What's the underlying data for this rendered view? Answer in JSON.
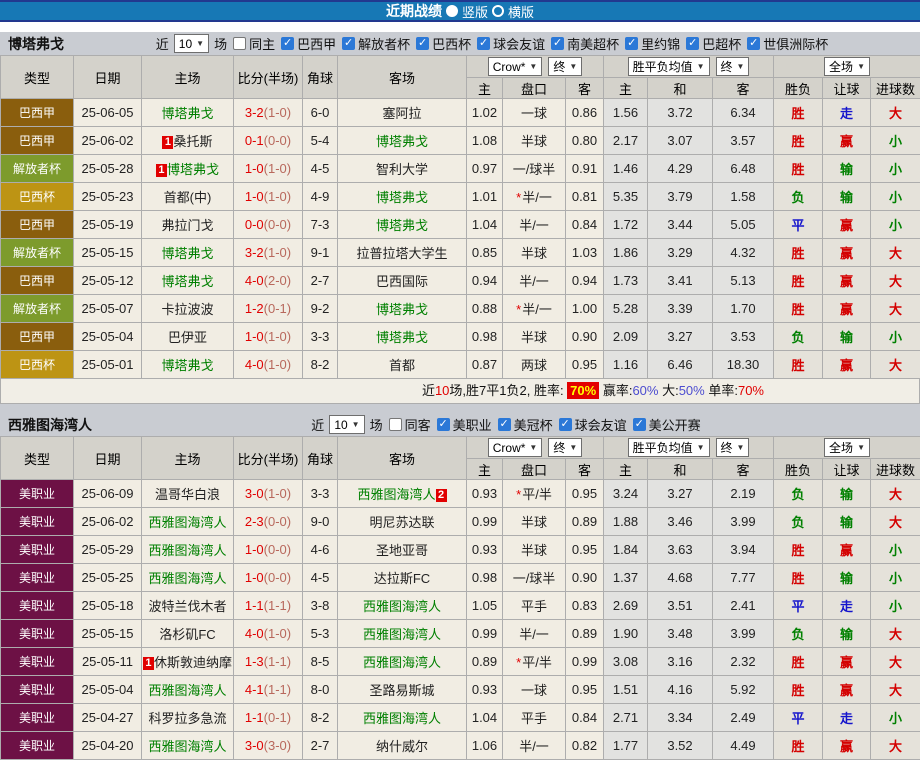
{
  "title_bar": {
    "title": "近期战绩",
    "options": [
      {
        "label": "竖版",
        "selected": true
      },
      {
        "label": "横版",
        "selected": false
      }
    ]
  },
  "colors": {
    "header_blue": "#1778b5",
    "win_red": "#d40000",
    "draw_blue": "#1414cc",
    "lose_green": "#008000",
    "focus_team_green": "#008000",
    "score_red": "#e10000",
    "badge_league_bra_a": "#8a5e0d",
    "badge_libertadores": "#7d9b2c",
    "badge_bra_cup": "#bd9414",
    "badge_mls": "#6d1145"
  },
  "columns": {
    "type": "类型",
    "date": "日期",
    "home": "主场",
    "score": "比分(半场)",
    "corner": "角球",
    "away": "客场",
    "odds_company": "Crow*",
    "odds_stage": "终",
    "avg_label": "胜平负均值",
    "avg_stage": "终",
    "scope": "全场",
    "o_home": "主",
    "o_handicap": "盘口",
    "o_away": "客",
    "a_win": "主",
    "a_draw": "和",
    "a_lose": "客",
    "r_outcome": "胜负",
    "r_handicap": "让球",
    "r_goals": "进球数"
  },
  "sections": [
    {
      "team": "博塔弗戈",
      "near": "近",
      "count": "10",
      "games": "场",
      "same": "同主",
      "leagues": [
        "巴西甲",
        "解放者杯",
        "巴西杯",
        "球会友谊",
        "南美超杯",
        "里约锦",
        "巴超杯",
        "世俱洲际杯"
      ],
      "rows": [
        {
          "league": "巴西甲",
          "lc": "#8a5e0d",
          "date": "25-06-05",
          "home": {
            "name": "博塔弗戈",
            "focus": true
          },
          "score": "3-2",
          "half": "(1-0)",
          "corner": "6-0",
          "away": {
            "name": "塞阿拉",
            "focus": false
          },
          "o1": "1.02",
          "star": false,
          "hcap": "一球",
          "o3": "0.86",
          "a1": "1.56",
          "a2": "3.72",
          "a3": "6.34",
          "r": [
            "胜",
            "win"
          ],
          "l": [
            "走",
            "draw"
          ],
          "g": [
            "大",
            "win"
          ]
        },
        {
          "league": "巴西甲",
          "lc": "#8a5e0d",
          "date": "25-06-02",
          "home": {
            "name": "桑托斯",
            "focus": false,
            "card": "1",
            "cardPos": "before"
          },
          "score": "0-1",
          "half": "(0-0)",
          "corner": "5-4",
          "away": {
            "name": "博塔弗戈",
            "focus": true
          },
          "o1": "1.08",
          "star": false,
          "hcap": "半球",
          "o3": "0.80",
          "a1": "2.17",
          "a2": "3.07",
          "a3": "3.57",
          "r": [
            "胜",
            "win"
          ],
          "l": [
            "赢",
            "win"
          ],
          "g": [
            "小",
            "lose"
          ]
        },
        {
          "league": "解放者杯",
          "lc": "#7d9b2c",
          "date": "25-05-28",
          "home": {
            "name": "博塔弗戈",
            "focus": true,
            "card": "1",
            "cardPos": "before"
          },
          "score": "1-0",
          "half": "(1-0)",
          "corner": "4-5",
          "away": {
            "name": "智利大学",
            "focus": false
          },
          "o1": "0.97",
          "star": false,
          "hcap": "一/球半",
          "o3": "0.91",
          "a1": "1.46",
          "a2": "4.29",
          "a3": "6.48",
          "r": [
            "胜",
            "win"
          ],
          "l": [
            "输",
            "lose"
          ],
          "g": [
            "小",
            "lose"
          ]
        },
        {
          "league": "巴西杯",
          "lc": "#bd9414",
          "date": "25-05-23",
          "home": {
            "name": "首都(中)",
            "focus": false
          },
          "score": "1-0",
          "half": "(1-0)",
          "corner": "4-9",
          "away": {
            "name": "博塔弗戈",
            "focus": true
          },
          "o1": "1.01",
          "star": true,
          "hcap": "半/一",
          "o3": "0.81",
          "a1": "5.35",
          "a2": "3.79",
          "a3": "1.58",
          "r": [
            "负",
            "lose"
          ],
          "l": [
            "输",
            "lose"
          ],
          "g": [
            "小",
            "lose"
          ]
        },
        {
          "league": "巴西甲",
          "lc": "#8a5e0d",
          "date": "25-05-19",
          "home": {
            "name": "弗拉门戈",
            "focus": false
          },
          "score": "0-0",
          "half": "(0-0)",
          "corner": "7-3",
          "away": {
            "name": "博塔弗戈",
            "focus": true
          },
          "o1": "1.04",
          "star": false,
          "hcap": "半/一",
          "o3": "0.84",
          "a1": "1.72",
          "a2": "3.44",
          "a3": "5.05",
          "r": [
            "平",
            "draw"
          ],
          "l": [
            "赢",
            "win"
          ],
          "g": [
            "小",
            "lose"
          ]
        },
        {
          "league": "解放者杯",
          "lc": "#7d9b2c",
          "date": "25-05-15",
          "home": {
            "name": "博塔弗戈",
            "focus": true
          },
          "score": "3-2",
          "half": "(1-0)",
          "corner": "9-1",
          "away": {
            "name": "拉普拉塔大学生",
            "focus": false
          },
          "o1": "0.85",
          "star": false,
          "hcap": "半球",
          "o3": "1.03",
          "a1": "1.86",
          "a2": "3.29",
          "a3": "4.32",
          "r": [
            "胜",
            "win"
          ],
          "l": [
            "赢",
            "win"
          ],
          "g": [
            "大",
            "win"
          ]
        },
        {
          "league": "巴西甲",
          "lc": "#8a5e0d",
          "date": "25-05-12",
          "home": {
            "name": "博塔弗戈",
            "focus": true
          },
          "score": "4-0",
          "half": "(2-0)",
          "corner": "2-7",
          "away": {
            "name": "巴西国际",
            "focus": false
          },
          "o1": "0.94",
          "star": false,
          "hcap": "半/一",
          "o3": "0.94",
          "a1": "1.73",
          "a2": "3.41",
          "a3": "5.13",
          "r": [
            "胜",
            "win"
          ],
          "l": [
            "赢",
            "win"
          ],
          "g": [
            "大",
            "win"
          ]
        },
        {
          "league": "解放者杯",
          "lc": "#7d9b2c",
          "date": "25-05-07",
          "home": {
            "name": "卡拉波波",
            "focus": false
          },
          "score": "1-2",
          "half": "(0-1)",
          "corner": "9-2",
          "away": {
            "name": "博塔弗戈",
            "focus": true
          },
          "o1": "0.88",
          "star": true,
          "hcap": "半/一",
          "o3": "1.00",
          "a1": "5.28",
          "a2": "3.39",
          "a3": "1.70",
          "r": [
            "胜",
            "win"
          ],
          "l": [
            "赢",
            "win"
          ],
          "g": [
            "大",
            "win"
          ]
        },
        {
          "league": "巴西甲",
          "lc": "#8a5e0d",
          "date": "25-05-04",
          "home": {
            "name": "巴伊亚",
            "focus": false
          },
          "score": "1-0",
          "half": "(1-0)",
          "corner": "3-3",
          "away": {
            "name": "博塔弗戈",
            "focus": true
          },
          "o1": "0.98",
          "star": false,
          "hcap": "半球",
          "o3": "0.90",
          "a1": "2.09",
          "a2": "3.27",
          "a3": "3.53",
          "r": [
            "负",
            "lose"
          ],
          "l": [
            "输",
            "lose"
          ],
          "g": [
            "小",
            "lose"
          ]
        },
        {
          "league": "巴西杯",
          "lc": "#bd9414",
          "date": "25-05-01",
          "home": {
            "name": "博塔弗戈",
            "focus": true
          },
          "score": "4-0",
          "half": "(1-0)",
          "corner": "8-2",
          "away": {
            "name": "首都",
            "focus": false
          },
          "o1": "0.87",
          "star": false,
          "hcap": "两球",
          "o3": "0.95",
          "a1": "1.16",
          "a2": "6.46",
          "a3": "18.30",
          "r": [
            "胜",
            "win"
          ],
          "l": [
            "赢",
            "win"
          ],
          "g": [
            "大",
            "win"
          ]
        }
      ],
      "summary": [
        {
          "t": "近",
          "c": "k"
        },
        {
          "t": "10",
          "c": "r"
        },
        {
          "t": "场,胜7平1负2, 胜率: ",
          "c": "k"
        },
        {
          "t": "70%",
          "c": "box"
        },
        {
          "t": " 赢率:",
          "c": "k"
        },
        {
          "t": "60%",
          "c": "b"
        },
        {
          "t": " 大:",
          "c": "k"
        },
        {
          "t": "50%",
          "c": "b"
        },
        {
          "t": " 单率:",
          "c": "k"
        },
        {
          "t": "70%",
          "c": "r"
        }
      ]
    },
    {
      "team": "西雅图海湾人",
      "near": "近",
      "count": "10",
      "games": "场",
      "same": "同客",
      "leagues": [
        "美职业",
        "美冠杯",
        "球会友谊",
        "美公开赛"
      ],
      "rows": [
        {
          "league": "美职业",
          "lc": "#6d1145",
          "date": "25-06-09",
          "home": {
            "name": "温哥华白浪",
            "focus": false
          },
          "score": "3-0",
          "half": "(1-0)",
          "corner": "3-3",
          "away": {
            "name": "西雅图海湾人",
            "focus": true,
            "card": "2",
            "cardPos": "after"
          },
          "o1": "0.93",
          "star": true,
          "hcap": "平/半",
          "o3": "0.95",
          "a1": "3.24",
          "a2": "3.27",
          "a3": "2.19",
          "r": [
            "负",
            "lose"
          ],
          "l": [
            "输",
            "lose"
          ],
          "g": [
            "大",
            "win"
          ]
        },
        {
          "league": "美职业",
          "lc": "#6d1145",
          "date": "25-06-02",
          "home": {
            "name": "西雅图海湾人",
            "focus": true
          },
          "score": "2-3",
          "half": "(0-0)",
          "corner": "9-0",
          "away": {
            "name": "明尼苏达联",
            "focus": false
          },
          "o1": "0.99",
          "star": false,
          "hcap": "半球",
          "o3": "0.89",
          "a1": "1.88",
          "a2": "3.46",
          "a3": "3.99",
          "r": [
            "负",
            "lose"
          ],
          "l": [
            "输",
            "lose"
          ],
          "g": [
            "大",
            "win"
          ]
        },
        {
          "league": "美职业",
          "lc": "#6d1145",
          "date": "25-05-29",
          "home": {
            "name": "西雅图海湾人",
            "focus": true
          },
          "score": "1-0",
          "half": "(0-0)",
          "corner": "4-6",
          "away": {
            "name": "圣地亚哥",
            "focus": false
          },
          "o1": "0.93",
          "star": false,
          "hcap": "半球",
          "o3": "0.95",
          "a1": "1.84",
          "a2": "3.63",
          "a3": "3.94",
          "r": [
            "胜",
            "win"
          ],
          "l": [
            "赢",
            "win"
          ],
          "g": [
            "小",
            "lose"
          ]
        },
        {
          "league": "美职业",
          "lc": "#6d1145",
          "date": "25-05-25",
          "home": {
            "name": "西雅图海湾人",
            "focus": true
          },
          "score": "1-0",
          "half": "(0-0)",
          "corner": "4-5",
          "away": {
            "name": "达拉斯FC",
            "focus": false
          },
          "o1": "0.98",
          "star": false,
          "hcap": "一/球半",
          "o3": "0.90",
          "a1": "1.37",
          "a2": "4.68",
          "a3": "7.77",
          "r": [
            "胜",
            "win"
          ],
          "l": [
            "输",
            "lose"
          ],
          "g": [
            "小",
            "lose"
          ]
        },
        {
          "league": "美职业",
          "lc": "#6d1145",
          "date": "25-05-18",
          "home": {
            "name": "波特兰伐木者",
            "focus": false
          },
          "score": "1-1",
          "half": "(1-1)",
          "corner": "3-8",
          "away": {
            "name": "西雅图海湾人",
            "focus": true
          },
          "o1": "1.05",
          "star": false,
          "hcap": "平手",
          "o3": "0.83",
          "a1": "2.69",
          "a2": "3.51",
          "a3": "2.41",
          "r": [
            "平",
            "draw"
          ],
          "l": [
            "走",
            "draw"
          ],
          "g": [
            "小",
            "lose"
          ]
        },
        {
          "league": "美职业",
          "lc": "#6d1145",
          "date": "25-05-15",
          "home": {
            "name": "洛杉矶FC",
            "focus": false
          },
          "score": "4-0",
          "half": "(1-0)",
          "corner": "5-3",
          "away": {
            "name": "西雅图海湾人",
            "focus": true
          },
          "o1": "0.99",
          "star": false,
          "hcap": "半/一",
          "o3": "0.89",
          "a1": "1.90",
          "a2": "3.48",
          "a3": "3.99",
          "r": [
            "负",
            "lose"
          ],
          "l": [
            "输",
            "lose"
          ],
          "g": [
            "大",
            "win"
          ]
        },
        {
          "league": "美职业",
          "lc": "#6d1145",
          "date": "25-05-11",
          "home": {
            "name": "休斯敦迪纳摩",
            "focus": false,
            "card": "1",
            "cardPos": "before"
          },
          "score": "1-3",
          "half": "(1-1)",
          "corner": "8-5",
          "away": {
            "name": "西雅图海湾人",
            "focus": true
          },
          "o1": "0.89",
          "star": true,
          "hcap": "平/半",
          "o3": "0.99",
          "a1": "3.08",
          "a2": "3.16",
          "a3": "2.32",
          "r": [
            "胜",
            "win"
          ],
          "l": [
            "赢",
            "win"
          ],
          "g": [
            "大",
            "win"
          ]
        },
        {
          "league": "美职业",
          "lc": "#6d1145",
          "date": "25-05-04",
          "home": {
            "name": "西雅图海湾人",
            "focus": true
          },
          "score": "4-1",
          "half": "(1-1)",
          "corner": "8-0",
          "away": {
            "name": "圣路易斯城",
            "focus": false
          },
          "o1": "0.93",
          "star": false,
          "hcap": "一球",
          "o3": "0.95",
          "a1": "1.51",
          "a2": "4.16",
          "a3": "5.92",
          "r": [
            "胜",
            "win"
          ],
          "l": [
            "赢",
            "win"
          ],
          "g": [
            "大",
            "win"
          ]
        },
        {
          "league": "美职业",
          "lc": "#6d1145",
          "date": "25-04-27",
          "home": {
            "name": "科罗拉多急流",
            "focus": false
          },
          "score": "1-1",
          "half": "(0-1)",
          "corner": "8-2",
          "away": {
            "name": "西雅图海湾人",
            "focus": true
          },
          "o1": "1.04",
          "star": false,
          "hcap": "平手",
          "o3": "0.84",
          "a1": "2.71",
          "a2": "3.34",
          "a3": "2.49",
          "r": [
            "平",
            "draw"
          ],
          "l": [
            "走",
            "draw"
          ],
          "g": [
            "小",
            "lose"
          ]
        },
        {
          "league": "美职业",
          "lc": "#6d1145",
          "date": "25-04-20",
          "home": {
            "name": "西雅图海湾人",
            "focus": true
          },
          "score": "3-0",
          "half": "(3-0)",
          "corner": "2-7",
          "away": {
            "name": "纳什威尔",
            "focus": false
          },
          "o1": "1.06",
          "star": false,
          "hcap": "半/一",
          "o3": "0.82",
          "a1": "1.77",
          "a2": "3.52",
          "a3": "4.49",
          "r": [
            "胜",
            "win"
          ],
          "l": [
            "赢",
            "win"
          ],
          "g": [
            "大",
            "win"
          ]
        }
      ],
      "summary": null
    }
  ]
}
